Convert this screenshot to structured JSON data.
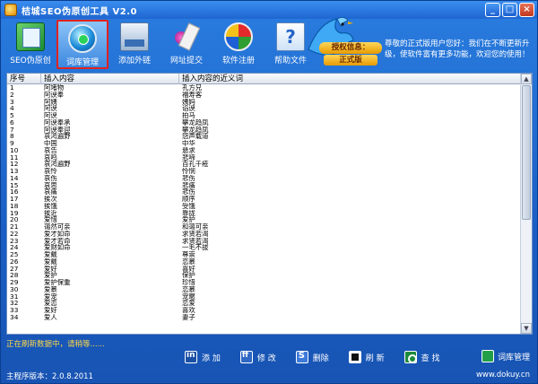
{
  "window": {
    "title": "桔城SEO伪原创工具 V2.0"
  },
  "toolbar": [
    {
      "name": "seo-tool",
      "label": "SEO伪原创",
      "icon": "document-icon"
    },
    {
      "name": "thesaurus",
      "label": "词库管理",
      "icon": "globe-icon",
      "active": true
    },
    {
      "name": "add-link",
      "label": "添加外链",
      "icon": "monitor-icon"
    },
    {
      "name": "url-submit",
      "label": "网址提交",
      "icon": "pen-icon"
    },
    {
      "name": "register",
      "label": "软件注册",
      "icon": "windows-icon"
    },
    {
      "name": "help",
      "label": "帮助文件",
      "icon": "help-icon"
    }
  ],
  "auth": {
    "label": "授权信息：",
    "value": "正式版"
  },
  "notice": "尊敬的正式版用户您好：我们在不断更新升级，使软件富有更多功能，欢迎您的使用！",
  "table": {
    "headers": [
      "序号",
      "插入内容",
      "插入内容的近义词"
    ],
    "rows": [
      [
        "1",
        "阿堵物",
        "孔方兄"
      ],
      [
        "2",
        "阿谀奉",
        "福寿客"
      ],
      [
        "3",
        "阿姨",
        "姨妈"
      ],
      [
        "4",
        "阿谀",
        "谄谀"
      ],
      [
        "5",
        "阿谀",
        "拍马"
      ],
      [
        "6",
        "阿谀奉承",
        "攀龙趋凤"
      ],
      [
        "7",
        "阿谀奉迎",
        "攀龙趋凤"
      ],
      [
        "8",
        "哀鸿遍野",
        "怨声载道"
      ],
      [
        "9",
        "中国",
        "中华"
      ],
      [
        "10",
        "哀告",
        "悬求"
      ],
      [
        "11",
        "哀鸣",
        "悲啼"
      ],
      [
        "12",
        "哀鸿遍野",
        "百孔千疮"
      ],
      [
        "13",
        "哀怜",
        "怜悯"
      ],
      [
        "14",
        "哀伤",
        "悲伤"
      ],
      [
        "15",
        "哀思",
        "悲痛"
      ],
      [
        "16",
        "哀痛",
        "悲伤"
      ],
      [
        "17",
        "挨次",
        "顺序"
      ],
      [
        "18",
        "挨饿",
        "受饿"
      ],
      [
        "19",
        "挨近",
        "靠拢"
      ],
      [
        "20",
        "爱惜",
        "爱护"
      ],
      [
        "21",
        "蔼然可亲",
        "和蔼可亲"
      ],
      [
        "22",
        "爱才如命",
        "求贤若渴"
      ],
      [
        "23",
        "爱才若命",
        "求贤若渴"
      ],
      [
        "24",
        "爱财如命",
        "一毛不拔"
      ],
      [
        "25",
        "爱戴",
        "尊崇"
      ],
      [
        "26",
        "爱戴",
        "恋慕"
      ],
      [
        "27",
        "爱好",
        "喜好"
      ],
      [
        "28",
        "爱护",
        "保护"
      ],
      [
        "29",
        "爱护保重",
        "珍惜"
      ],
      [
        "30",
        "爱慕",
        "恋慕"
      ],
      [
        "31",
        "爱宠",
        "宠暱"
      ],
      [
        "32",
        "爱恋",
        "恋爱"
      ],
      [
        "33",
        "爱好",
        "喜欢"
      ],
      [
        "34",
        "爱人",
        "妻子"
      ]
    ]
  },
  "status": "正在刷新数据中，请稍等......",
  "bottom_buttons": [
    {
      "name": "add-button",
      "label": "添 加",
      "icon": "add-icon"
    },
    {
      "name": "edit-button",
      "label": "修 改",
      "icon": "edit-icon"
    },
    {
      "name": "delete-button",
      "label": "删除",
      "icon": "delete-icon"
    },
    {
      "name": "refresh-button",
      "label": "刷 新",
      "icon": "refresh-icon"
    },
    {
      "name": "find-button",
      "label": "查 找",
      "icon": "find-icon"
    }
  ],
  "library_button": {
    "label": "词库管理",
    "icon": "library-icon"
  },
  "footer": {
    "version": "主程序版本：2.0.8.2011",
    "website": "www.dokuy.cn"
  },
  "colors": {
    "accent": "#1e63c7",
    "highlight_border": "#e2221f",
    "status_text": "#ffd84a"
  }
}
